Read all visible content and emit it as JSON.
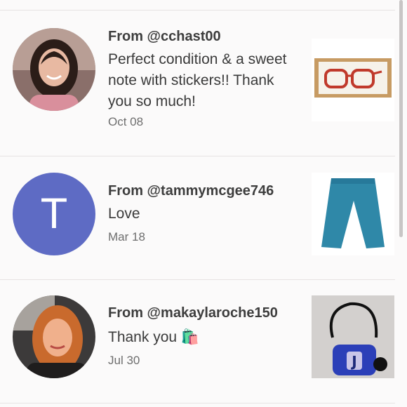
{
  "colors": {
    "background": "#fbfafa",
    "divider": "#e6e3e3",
    "avatar_letter_bg": "#5e6bc4",
    "text": "#3a3a3a",
    "muted": "#6e6e6e"
  },
  "reviews": [
    {
      "from": "From @cchast00",
      "message": "Perfect condition & a sweet note with stickers!! Thank you so much!",
      "date": "Oct 08",
      "avatar_icon": "user-photo-icon",
      "item_icon": "eyeglasses-box-icon"
    },
    {
      "from": "From @tammymcgee746",
      "message": "Love",
      "date": "Mar 18",
      "avatar_letter": "T",
      "item_icon": "teal-pants-icon"
    },
    {
      "from": "From @makaylaroche150",
      "message": "Thank you 🛍️",
      "date": "Jul 30",
      "avatar_icon": "user-photo-icon",
      "item_icon": "crossbody-bag-icon"
    }
  ]
}
